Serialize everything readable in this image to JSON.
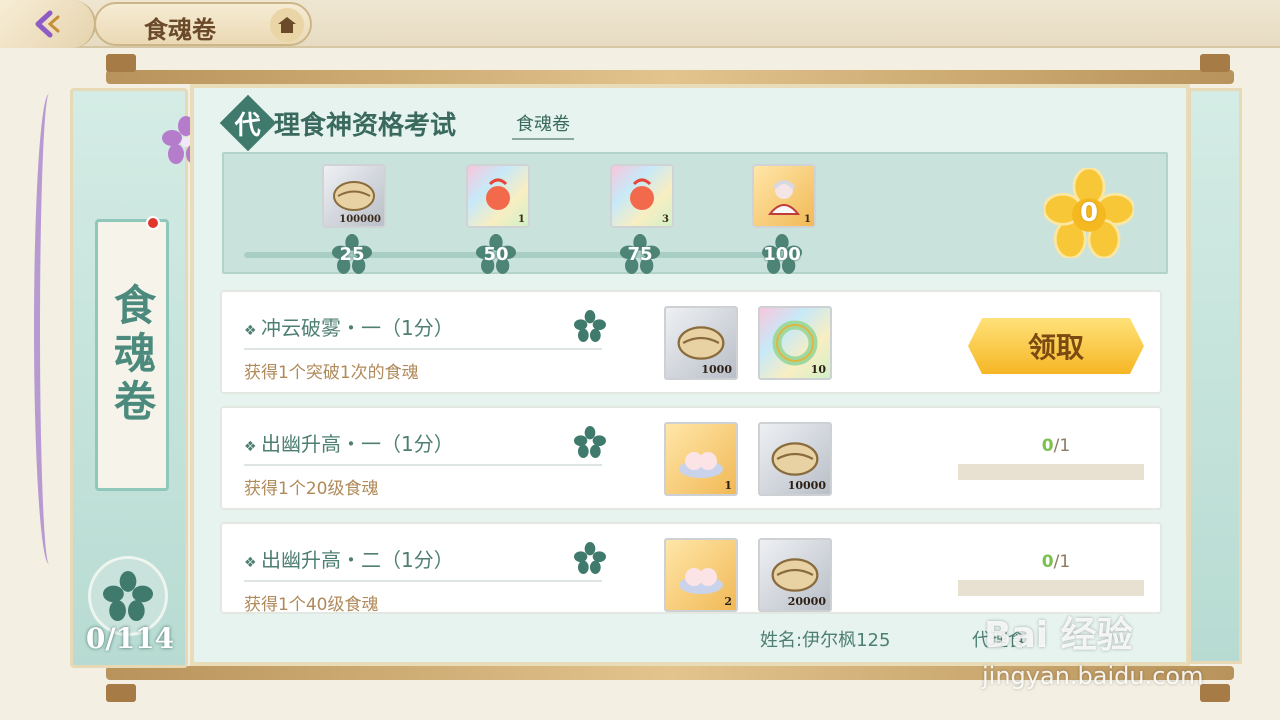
{
  "header": {
    "title": "食魂卷"
  },
  "left_tab": {
    "label": "食魂卷",
    "score": "0/114"
  },
  "exam": {
    "title_first_char": "代",
    "title_rest": "理食神资格考试",
    "sub_tab": "食魂卷"
  },
  "milestones": [
    {
      "label": "25",
      "reward_qty": "100000",
      "reward_icon": "dumpling-coin-icon"
    },
    {
      "label": "50",
      "reward_qty": "1",
      "reward_icon": "firework-icon"
    },
    {
      "label": "75",
      "reward_qty": "3",
      "reward_icon": "firework-icon"
    },
    {
      "label": "100",
      "reward_qty": "1",
      "reward_icon": "character-portrait-icon"
    }
  ],
  "current_points": "0",
  "tasks": [
    {
      "name": "冲云破雾・一（1分）",
      "desc": "获得1个突破1次的食魂",
      "items": [
        {
          "icon": "dumpling-coin-icon",
          "qty": "1000"
        },
        {
          "icon": "ring-icon",
          "qty": "10"
        }
      ],
      "action": "领取"
    },
    {
      "name": "出幽升高・一（1分）",
      "desc": "获得1个20级食魂",
      "items": [
        {
          "icon": "bun-plate-icon",
          "qty": "1"
        },
        {
          "icon": "dumpling-coin-icon",
          "qty": "10000"
        }
      ],
      "progress_done": "0",
      "progress_total": "/1",
      "progress_value": 0
    },
    {
      "name": "出幽升高・二（1分）",
      "desc": "获得1个40级食魂",
      "items": [
        {
          "icon": "bun-plate-icon",
          "qty": "2"
        },
        {
          "icon": "dumpling-coin-icon",
          "qty": "20000"
        }
      ],
      "progress_done": "0",
      "progress_total": "/1",
      "progress_value": 0
    }
  ],
  "footer": {
    "name": "姓名:伊尔枫125",
    "extra": "代理食"
  },
  "watermark": {
    "line1": "Bai 经验",
    "line2": "jingyan.baidu.com"
  },
  "colors": {
    "accent": "#4f7f73",
    "claim": "#f6b624",
    "progress": "#7ac14d"
  }
}
